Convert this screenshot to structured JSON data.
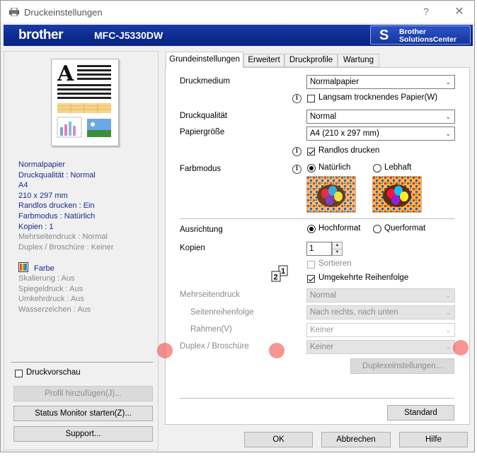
{
  "window": {
    "title": "Druckeinstellungen",
    "help": "?",
    "close": "✕"
  },
  "banner": {
    "brand": "brother",
    "model": "MFC-J5330DW",
    "solutions_line1": "Brother",
    "solutions_line2": "SolutionsCenter"
  },
  "summary": {
    "lines": [
      {
        "text": "Normalpapier",
        "style": "blue"
      },
      {
        "text": "Druckqualität : Normal",
        "style": "blue"
      },
      {
        "text": "A4",
        "style": "blue"
      },
      {
        "text": "210 x 297 mm",
        "style": "blue"
      },
      {
        "text": "Randlos drucken : Ein",
        "style": "blue"
      },
      {
        "text": "Farbmodus : Natürlich",
        "style": "blue"
      },
      {
        "text": "Kopien : 1",
        "style": "blue"
      },
      {
        "text": "Mehrseitendruck : Normal",
        "style": "gray"
      },
      {
        "text": "Duplex / Broschüre : Keiner",
        "style": "gray"
      }
    ],
    "color_label": "Farbe",
    "lines2": [
      "Skalierung : Aus",
      "Spiegeldruck : Aus",
      "Umkehrdruck : Aus",
      "Wasserzeichen : Aus"
    ]
  },
  "left": {
    "print_preview": "Druckvorschau",
    "add_profile": "Profil hinzufügen(J)...",
    "status_monitor": "Status Monitor starten(Z)...",
    "support": "Support..."
  },
  "tabs": [
    "Grundeinstellungen",
    "Erweitert",
    "Druckprofile",
    "Wartung"
  ],
  "form": {
    "media_label": "Druckmedium",
    "media_value": "Normalpapier",
    "slow_dry": "Langsam trocknendes Papier(W)",
    "quality_label": "Druckqualität",
    "quality_value": "Normal",
    "paper_label": "Papiergröße",
    "paper_value": "A4 (210 x 297 mm)",
    "borderless": "Randlos drucken",
    "color_mode_label": "Farbmodus",
    "color_natural": "Natürlich",
    "color_vivid": "Lebhaft",
    "orientation_label": "Ausrichtung",
    "portrait": "Hochformat",
    "landscape": "Querformat",
    "copies_label": "Kopien",
    "copies_value": "1",
    "collate": "Sortieren",
    "reverse": "Umgekehrte Reihenfolge",
    "multipage_label": "Mehrseitendruck",
    "multipage_value": "Normal",
    "page_order_label": "Seitenreihenfolge",
    "page_order_value": "Nach rechts, nach unten",
    "border_label": "Rahmen(V)",
    "border_value": "Keiner",
    "duplex_label": "Duplex / Broschüre",
    "duplex_value": "Keiner",
    "duplex_settings": "Duplexeinstellungen...",
    "standard": "Standard"
  },
  "footer": {
    "ok": "OK",
    "cancel": "Abbrechen",
    "help": "Hilfe"
  },
  "colors": {
    "banner": "#0b2a8f",
    "summary_blue": "#1b2a8a",
    "disabled_gray": "#8a8a8a"
  }
}
